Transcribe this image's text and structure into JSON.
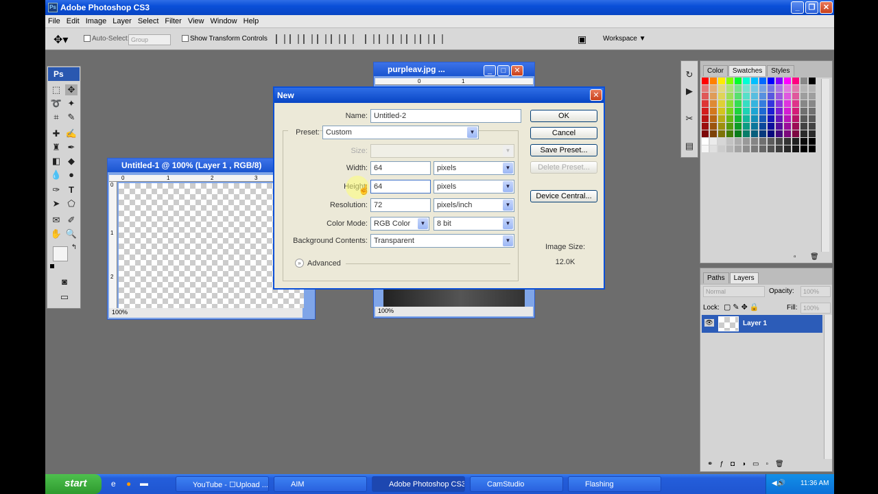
{
  "app": {
    "title": "Adobe Photoshop CS3"
  },
  "menu": [
    "File",
    "Edit",
    "Image",
    "Layer",
    "Select",
    "Filter",
    "View",
    "Window",
    "Help"
  ],
  "options": {
    "auto_select": "Auto-Select:",
    "group": "Group",
    "show_transform": "Show Transform Controls",
    "workspace": "Workspace"
  },
  "toolbox": {
    "logo": "Ps"
  },
  "doc1": {
    "title": "Untitled-1 @ 100% (Layer 1 , RGB/8)",
    "zoom": "100%",
    "ruler_top": [
      "0",
      "1",
      "2",
      "3"
    ],
    "ruler_left": [
      "0",
      "1",
      "2"
    ]
  },
  "doc2": {
    "title": "purpleav.jpg ...",
    "zoom": "100%",
    "ruler_top": [
      "0",
      "1"
    ]
  },
  "dialog": {
    "title": "New",
    "name_label": "Name:",
    "name_value": "Untitled-2",
    "preset_label": "Preset:",
    "preset_value": "Custom",
    "size_label": "Size:",
    "width_label": "Width:",
    "width_value": "64",
    "width_unit": "pixels",
    "height_label": "Height:",
    "height_value": "64",
    "height_unit": "pixels",
    "resolution_label": "Resolution:",
    "resolution_value": "72",
    "resolution_unit": "pixels/inch",
    "colormode_label": "Color Mode:",
    "colormode_value": "RGB Color",
    "bitdepth_value": "8 bit",
    "background_label": "Background Contents:",
    "background_value": "Transparent",
    "advanced_label": "Advanced",
    "ok": "OK",
    "cancel": "Cancel",
    "save_preset": "Save Preset...",
    "delete_preset": "Delete Preset...",
    "device_central": "Device Central...",
    "image_size_label": "Image Size:",
    "image_size_value": "12.0K"
  },
  "swatches_panel": {
    "tabs": [
      "Color",
      "Swatches",
      "Styles"
    ]
  },
  "layers_panel": {
    "tabs": [
      "Paths",
      "Layers"
    ],
    "blend_mode": "Normal",
    "opacity_label": "Opacity:",
    "opacity_value": "100%",
    "lock_label": "Lock:",
    "fill_label": "Fill:",
    "fill_value": "100%",
    "layer_name": "Layer 1"
  },
  "taskbar": {
    "start": "start",
    "tasks": [
      "YouTube - ☐Upload ...",
      "AIM",
      "Adobe Photoshop CS3",
      "CamStudio",
      "Flashing"
    ],
    "clock": "11:36 AM"
  },
  "colors": {
    "xp_blue": "#0a4fd8",
    "layer_selected": "#2c5cb8",
    "taskbar": "#245edb"
  }
}
